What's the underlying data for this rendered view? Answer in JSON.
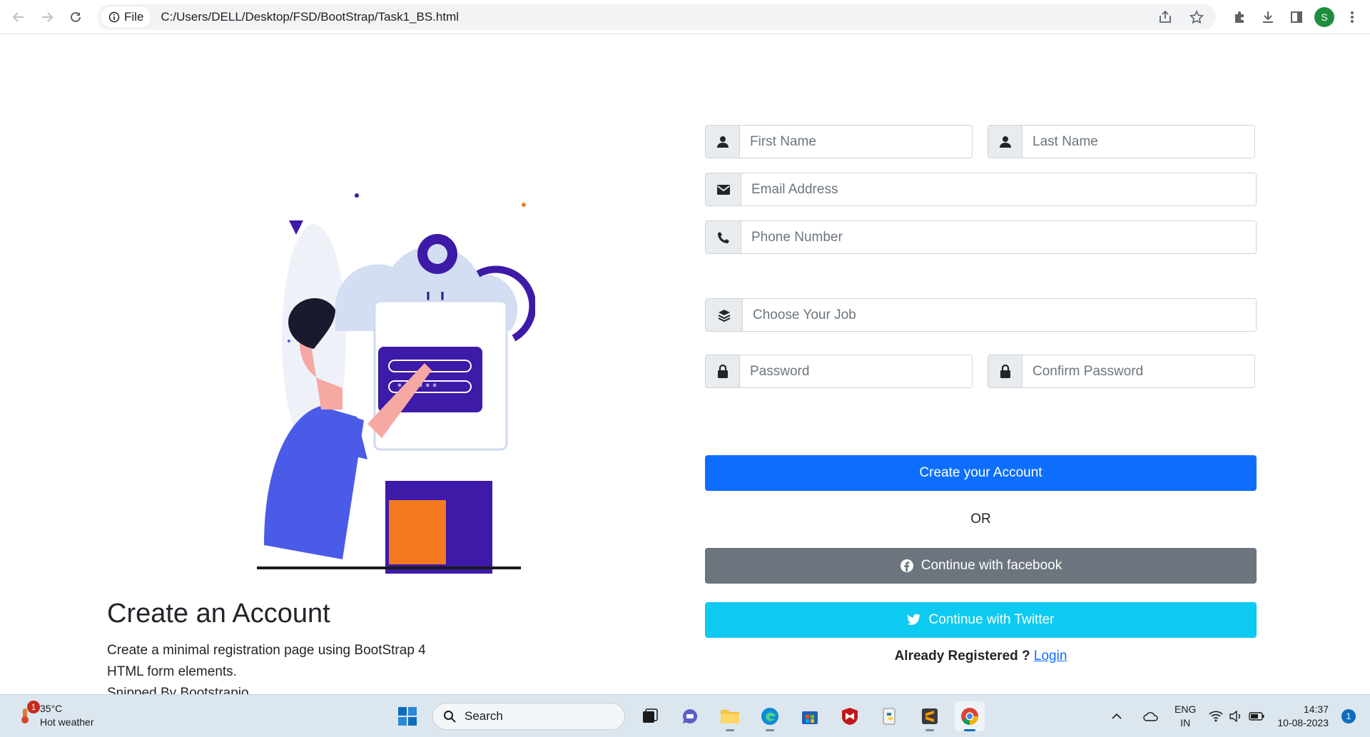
{
  "browser": {
    "site_label": "File",
    "url": "C:/Users/DELL/Desktop/FSD/BootStrap/Task1_BS.html",
    "profile_initial": "S"
  },
  "hero": {
    "title": "Create an Account",
    "description_lines": [
      "Create a minimal registration page using BootStrap 4",
      "HTML form elements.",
      "Snipped By Bootstrapio"
    ]
  },
  "form": {
    "first_name_placeholder": "First Name",
    "last_name_placeholder": "Last Name",
    "email_placeholder": "Email Address",
    "phone_placeholder": "Phone Number",
    "job_placeholder": "Choose Your Job",
    "password_placeholder": "Password",
    "confirm_password_placeholder": "Confirm Password",
    "create_button": "Create your Account",
    "or_text": "OR",
    "facebook_button": "Continue with facebook",
    "twitter_button": "Continue with Twitter",
    "already_text": "Already Registered ?",
    "login_link": "Login"
  },
  "taskbar": {
    "weather_temp": "35°C",
    "weather_desc": "Hot weather",
    "weather_badge": "1",
    "search_label": "Search",
    "lang_top": "ENG",
    "lang_bottom": "IN",
    "time": "14:37",
    "date": "10-08-2023",
    "notification_count": "1"
  },
  "colors": {
    "primary": "#0d6efd",
    "secondary": "#6c757d",
    "info": "#0dcaf0"
  }
}
